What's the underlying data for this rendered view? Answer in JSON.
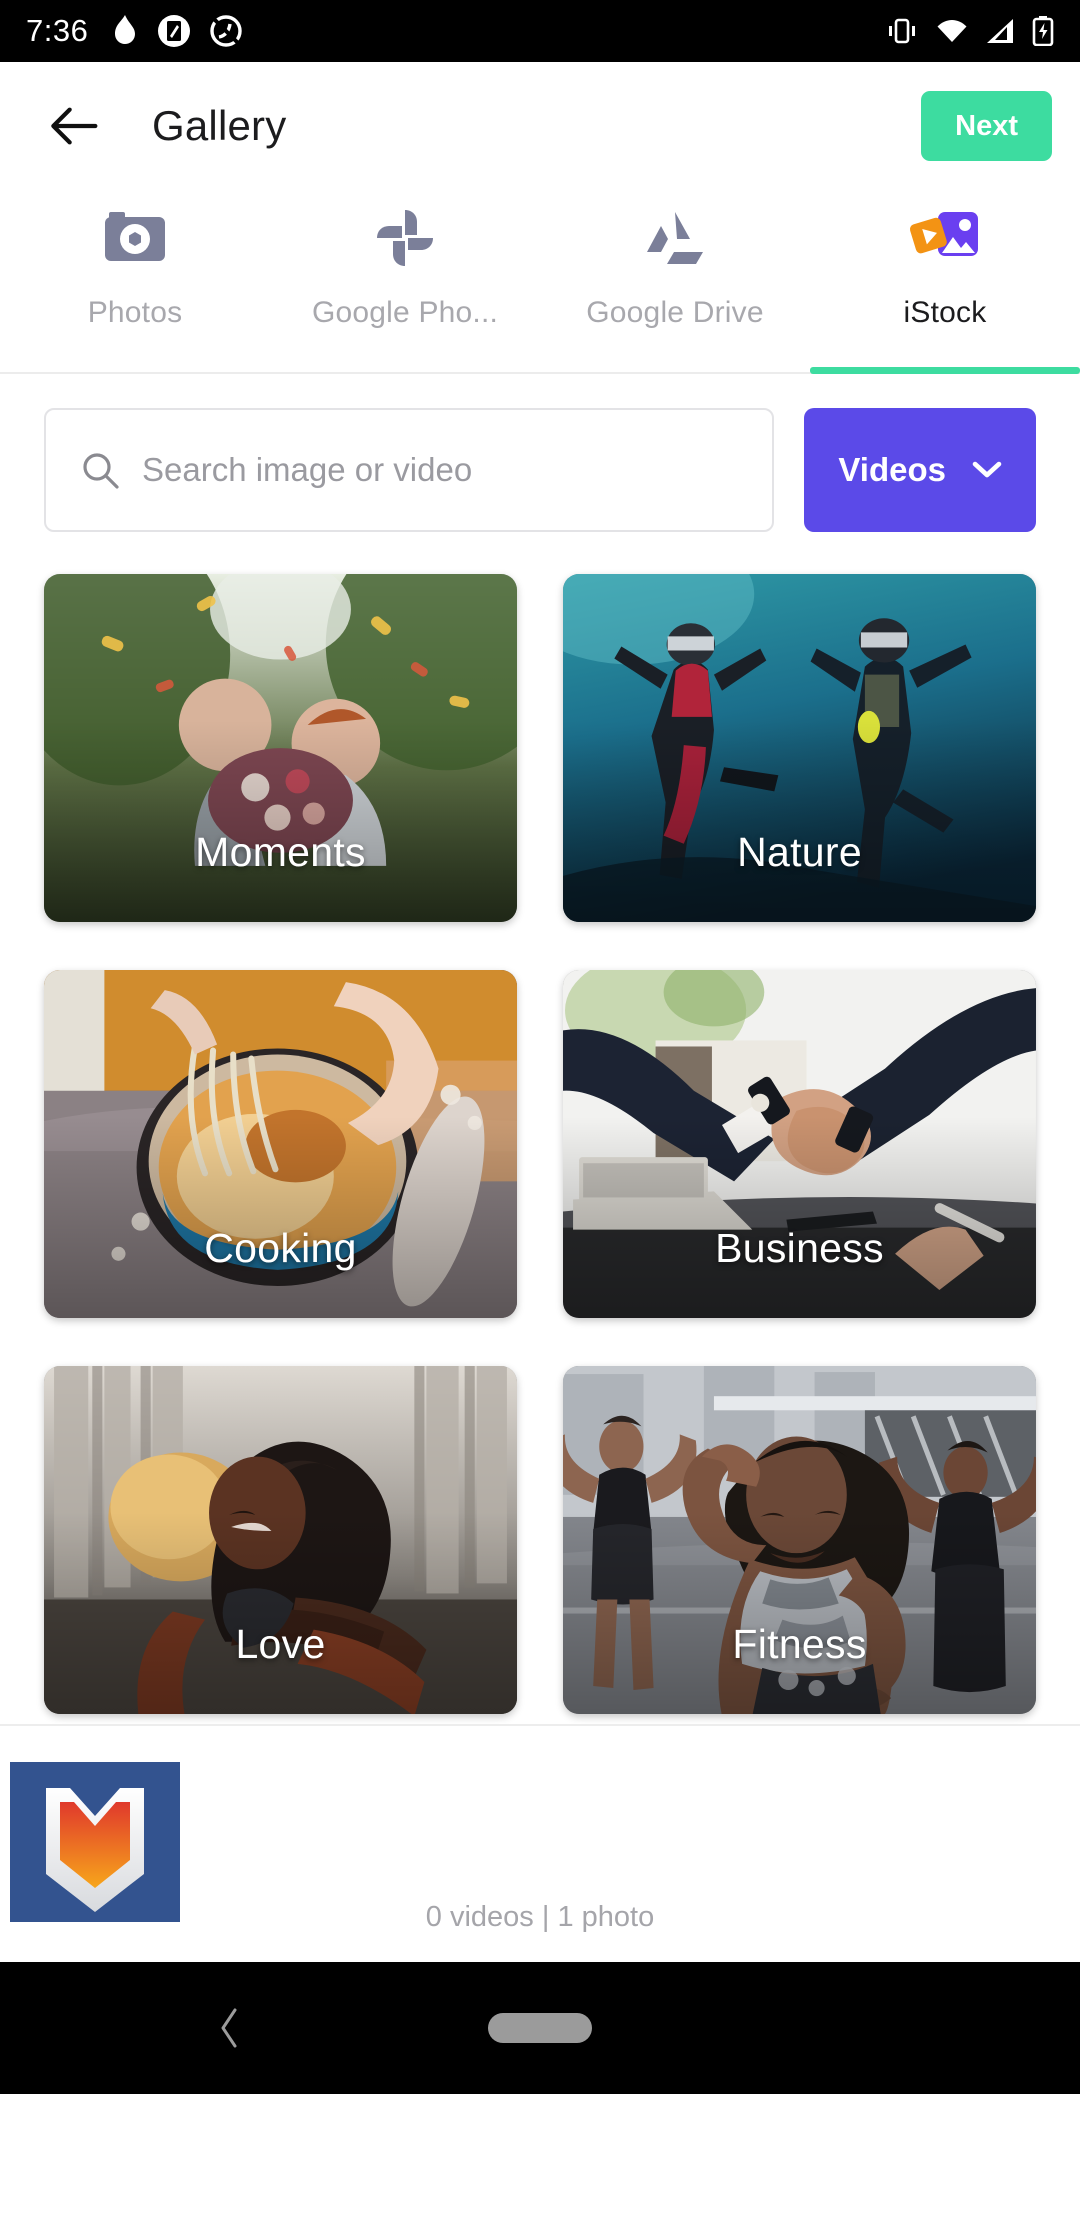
{
  "status_bar": {
    "time": "7:36",
    "left_icons": [
      "flame-icon",
      "screenshot-icon",
      "do-not-disturb-icon"
    ],
    "right_icons": [
      "vibrate-icon",
      "wifi-icon",
      "cellular-signal-icon",
      "battery-charging-icon"
    ]
  },
  "header": {
    "back_icon": "back-arrow-icon",
    "title": "Gallery",
    "next_label": "Next",
    "next_color": "#3ddca0"
  },
  "tabs": [
    {
      "label": "Photos",
      "icon": "camera-icon",
      "active": false
    },
    {
      "label": "Google Pho...",
      "icon": "google-photos-icon",
      "active": false
    },
    {
      "label": "Google Drive",
      "icon": "google-drive-icon",
      "active": false
    },
    {
      "label": "iStock",
      "icon": "istock-icon",
      "active": true
    }
  ],
  "search": {
    "placeholder": "Search image or video",
    "value": "",
    "icon": "search-icon"
  },
  "filter": {
    "label": "Videos",
    "icon": "chevron-down-icon",
    "color": "#5b4ae8"
  },
  "categories": [
    {
      "label": "Moments",
      "theme": "wedding-confetti"
    },
    {
      "label": "Nature",
      "theme": "underwater-divers"
    },
    {
      "label": "Cooking",
      "theme": "whisking-batter"
    },
    {
      "label": "Business",
      "theme": "handshake-desk"
    },
    {
      "label": "Love",
      "theme": "city-hug"
    },
    {
      "label": "Fitness",
      "theme": "urban-flexing"
    }
  ],
  "footer": {
    "selected_thumbnail": "app-logo-thumbnail",
    "count_text": "0 videos | 1 photo"
  },
  "navbar": {
    "back_icon": "nav-back-icon",
    "home_pill": "nav-home-pill"
  }
}
